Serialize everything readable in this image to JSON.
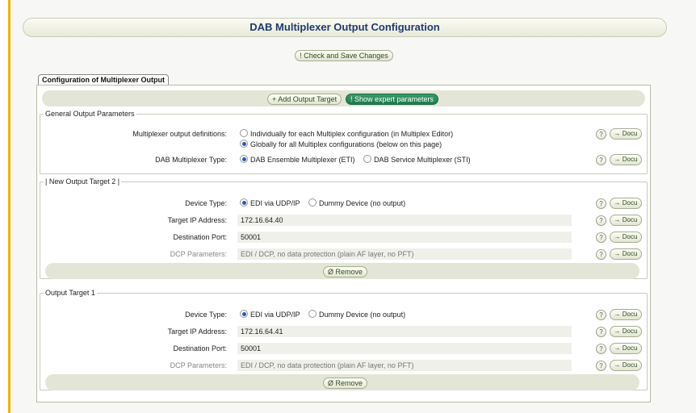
{
  "page_title": "DAB Multiplexer Output Configuration",
  "check_save_label": "! Check and Save Changes",
  "tab_label": "Configuration of Multiplexer Output",
  "toolbar": {
    "add_target": "+ Add Output Target",
    "show_expert": "! Show expert parameters"
  },
  "help_glyph": "?",
  "docu_label": "→ Docu",
  "general": {
    "legend": "General Output Parameters",
    "mux_defs_label": "Multiplexer output definitions:",
    "mux_defs_opt1": "Individually for each Multiplex configuration (in Multiplex Editor)",
    "mux_defs_opt2": "Globally for all Multiplex configurations (below on this page)",
    "mux_type_label": "DAB Multiplexer Type:",
    "mux_type_opt1": "DAB Ensemble Multiplexer (ETI)",
    "mux_type_opt2": "DAB Service Multiplexer (STI)"
  },
  "targets": [
    {
      "legend": "| New Output Target 2 |",
      "device_label": "Device Type:",
      "device_opt1": "EDI via UDP/IP",
      "device_opt2": "Dummy Device (no output)",
      "ip_label": "Target IP Address:",
      "ip_value": "172.16.64.40",
      "port_label": "Destination Port:",
      "port_value": "50001",
      "dcp_label": "DCP Parameters:",
      "dcp_value": "EDI / DCP, no data protection (plain AF layer, no PFT)",
      "remove_label": "Ø Remove"
    },
    {
      "legend": "Output Target 1",
      "device_label": "Device Type:",
      "device_opt1": "EDI via UDP/IP",
      "device_opt2": "Dummy Device (no output)",
      "ip_label": "Target IP Address:",
      "ip_value": "172.16.64.41",
      "port_label": "Destination Port:",
      "port_value": "50001",
      "dcp_label": "DCP Parameters:",
      "dcp_value": "EDI / DCP, no data protection (plain AF layer, no PFT)",
      "remove_label": "Ø Remove"
    }
  ]
}
